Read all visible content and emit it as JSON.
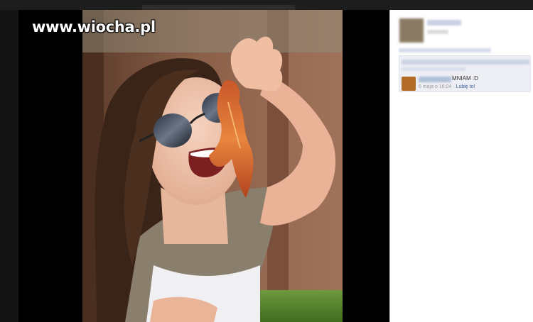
{
  "watermark": {
    "text": "www.wiocha.pl"
  },
  "photo": {
    "alt_icon": "photo-of-girl-with-bacon-icon"
  },
  "comment": {
    "text": "MNIAM :D",
    "timestamp": "6 maja o 16:24",
    "separator": "·",
    "like_label": "Lubię to!"
  },
  "colors": {
    "panel_bg": "#ffffff",
    "comment_bg": "#edeff4",
    "link": "#3b5998"
  }
}
